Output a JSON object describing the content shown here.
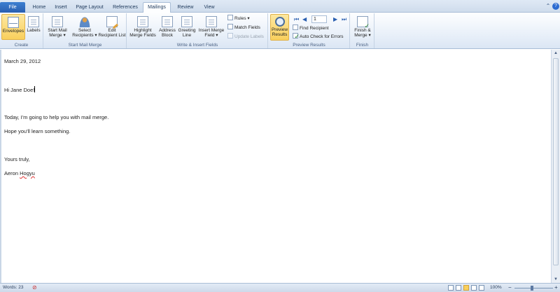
{
  "tabs": [
    {
      "label": "File",
      "key": "file"
    },
    {
      "label": "Home",
      "key": "home"
    },
    {
      "label": "Insert",
      "key": "insert"
    },
    {
      "label": "Page Layout",
      "key": "page-layout"
    },
    {
      "label": "References",
      "key": "references"
    },
    {
      "label": "Mailings",
      "key": "mailings"
    },
    {
      "label": "Review",
      "key": "review"
    },
    {
      "label": "View",
      "key": "view"
    }
  ],
  "ribbon": {
    "create": {
      "label": "Create",
      "envelopes": "Envelopes",
      "labels": "Labels"
    },
    "start_mail_merge": {
      "label": "Start Mail Merge",
      "start_mail_merge_1": "Start Mail",
      "start_mail_merge_2": "Merge ▾",
      "select_recipients_1": "Select",
      "select_recipients_2": "Recipients ▾",
      "edit_list_1": "Edit",
      "edit_list_2": "Recipient List"
    },
    "write_insert": {
      "label": "Write & Insert Fields",
      "highlight_1": "Highlight",
      "highlight_2": "Merge Fields",
      "address_1": "Address",
      "address_2": "Block",
      "greeting_1": "Greeting",
      "greeting_2": "Line",
      "insert_field_1": "Insert Merge",
      "insert_field_2": "Field ▾",
      "rules": "Rules ▾",
      "match_fields": "Match Fields",
      "update_labels": "Update Labels"
    },
    "preview": {
      "label": "Preview Results",
      "preview_1": "Preview",
      "preview_2": "Results",
      "record": "1",
      "find_recipient": "Find Recipient",
      "auto_check": "Auto Check for Errors"
    },
    "finish": {
      "label": "Finish",
      "finish_1": "Finish &",
      "finish_2": "Merge ▾"
    }
  },
  "document": {
    "date": "March 29, 2012",
    "greeting": "Hi Jane Doe!",
    "body1": "Today, I'm going to help you with mail merge.",
    "body2": "Hope you'll learn something.",
    "closing": "Yours truly,",
    "signature_first": "Aeron",
    "signature_last": "Hogyu"
  },
  "status": {
    "words": "Words: 23",
    "zoom": "100%"
  }
}
